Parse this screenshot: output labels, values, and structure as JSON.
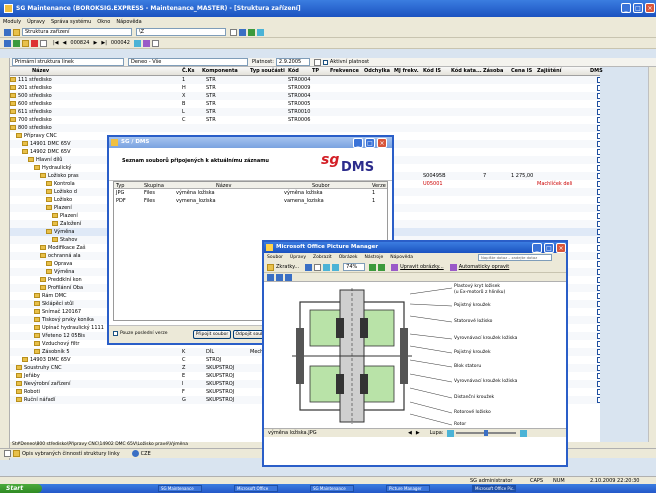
{
  "app": {
    "title": "SG Maintenance (BOROKSIG.EXPRESS - Maintenance_MASTER) - [Struktura zařízení]",
    "menu": [
      "Moduly",
      "Úpravy",
      "Správa systému",
      "Okno",
      "Nápověda"
    ],
    "toolbar1": {
      "combo_label": "Struktura zařízení",
      "combo_filter": "\\Z"
    },
    "toolbar2": {
      "record_prev": "000824",
      "record_next": "000042"
    },
    "filter": {
      "tree_combo": "Primární struktura linek",
      "zone_combo": "Deneo - Vše",
      "validity_label": "Platnost:",
      "validity_date": "2.9.2005",
      "active_validity": "Aktivní platnost"
    }
  },
  "grid": {
    "columns": [
      "Název",
      "Č.Ks",
      "Komponenta",
      "Typ součásti",
      "Kód",
      "TP",
      "Frekvence",
      "Odchylka",
      "MJ frekv.",
      "Kód IS",
      "Kód kata...",
      "Zásoba",
      "Cena IS",
      "Zajištění",
      "DMS"
    ],
    "rows": [
      {
        "name": "111 středisko",
        "ks": "1",
        "komp": "STR",
        "kod": "STR0004"
      },
      {
        "name": "201 středisko",
        "ks": "H",
        "komp": "STR",
        "kod": "STR0009"
      },
      {
        "name": "500 středisko",
        "ks": "X",
        "komp": "STR",
        "kod": "STR0004"
      },
      {
        "name": "600 středisko",
        "ks": "B",
        "komp": "STR",
        "kod": "STR0005"
      },
      {
        "name": "611 středisko",
        "ks": "L",
        "komp": "STR",
        "kod": "STR0010"
      },
      {
        "name": "700 středisko",
        "ks": "C",
        "komp": "STR",
        "kod": "STR0006"
      },
      {
        "name": "800 středisko",
        "ks": "",
        "komp": "",
        "kod": ""
      },
      {
        "name": "Přípravy CNC",
        "ks": "",
        "komp": "",
        "kod": ""
      },
      {
        "name": "14901 DMC 65V",
        "ks": "",
        "komp": "",
        "kod": "ST0001",
        "kodis": ""
      },
      {
        "name": "14902 DMC 65V",
        "ks": "",
        "komp": "",
        "kod": "ST0001",
        "kodis": ""
      },
      {
        "name": "Hlavní dílů",
        "ks": "",
        "komp": "",
        "kod": ""
      },
      {
        "name": "Hydraulický",
        "ks": "",
        "komp": "",
        "kod": ""
      },
      {
        "name": "Ložisko pras",
        "ks": "",
        "komp": "",
        "kod": "15483",
        "kodis": "S00495B",
        "zasoba": "7",
        "cena": "1 275,00"
      },
      {
        "name": "Kontrola",
        "ks": "",
        "komp": "",
        "kod": "den",
        "kodis": "U05001",
        "zajisteni": "Machlíček deli"
      },
      {
        "name": "Ložisko d",
        "ks": "",
        "komp": "",
        "kod": ""
      },
      {
        "name": "Ložisko",
        "ks": "",
        "komp": "",
        "kod": ""
      },
      {
        "name": "Plazení",
        "ks": "",
        "komp": "",
        "kod": ""
      },
      {
        "name": "Plazení",
        "ks": "",
        "komp": "",
        "kod": ""
      },
      {
        "name": "Založení",
        "ks": "",
        "komp": "",
        "kod": ""
      },
      {
        "name": "Výměna",
        "ks": "",
        "komp": "",
        "kod": ""
      },
      {
        "name": "Stahov",
        "ks": "",
        "komp": "",
        "kod": ""
      },
      {
        "name": "Modifikace Zaš",
        "ks": "",
        "komp": "",
        "kod": ""
      },
      {
        "name": "ochranná ala",
        "ks": "",
        "komp": "",
        "kod": ""
      },
      {
        "name": "Oprava",
        "ks": "",
        "komp": "",
        "kod": ""
      },
      {
        "name": "Výměna",
        "ks": "",
        "komp": "",
        "kod": ""
      },
      {
        "name": "Preddklní kon",
        "ks": "",
        "komp": "",
        "kod": ""
      },
      {
        "name": "Profilánní Oba",
        "ks": "",
        "komp": "",
        "kod": ""
      },
      {
        "name": "Rám DMC",
        "ks": "",
        "komp": "",
        "kod": ""
      },
      {
        "name": "Sklápěcí stůl",
        "ks": "",
        "komp": "",
        "kod": ""
      },
      {
        "name": "Snímač 120167",
        "ks": "F",
        "komp": "DÍL",
        "typ": "Elektro"
      },
      {
        "name": "Tiskový prvky konika",
        "ks": "H",
        "komp": "DÍL",
        "typ": "Mechan"
      },
      {
        "name": "Upínač hydraulický 1111",
        "ks": "G",
        "komp": "DÍL",
        "typ": "Mechan"
      },
      {
        "name": "Vřeteno 12 05Bis",
        "ks": "J",
        "komp": "DÍL",
        "typ": "Mechan"
      },
      {
        "name": "Vzduchový filtr",
        "ks": "L",
        "komp": "DÍL",
        "typ": "Mechan"
      },
      {
        "name": "Zásobník 5",
        "ks": "K",
        "komp": "DÍL",
        "typ": "Mechan"
      },
      {
        "name": "14903 DMC 65V",
        "ks": "C",
        "komp": "STROJ",
        "typ": ""
      },
      {
        "name": "Soustruhy CNC",
        "ks": "Z",
        "komp": "SKUPSTROJ",
        "typ": ""
      },
      {
        "name": "Jeřáby",
        "ks": "E",
        "komp": "SKUPSTROJ",
        "typ": ""
      },
      {
        "name": "Nevýrobní zařízení",
        "ks": "I",
        "komp": "SKUPSTROJ",
        "typ": ""
      },
      {
        "name": "Roboti",
        "ks": "F",
        "komp": "SKUPSTROJ",
        "typ": "",
        "kod": "SST0015"
      },
      {
        "name": "Ruční nářadí",
        "ks": "G",
        "komp": "SKUPSTROJ",
        "typ": "",
        "kod": "SST0013"
      }
    ]
  },
  "status": {
    "path": "St#Deneo\\800 středisko\\Přípravy CNC\\14902 DMC 65V\\Ložisko pravé\\Výměna",
    "copy_label": "Opis vybraných činností struktury linky",
    "country": "CZE"
  },
  "appstatus": {
    "user": "SG administrator",
    "caps": "CAPS",
    "num": "NUM",
    "datetime": "2.10.2009 22:20:30"
  },
  "taskbar": {
    "start": "Start",
    "tasks": [
      "SG Maintenance",
      "Microsoft Office",
      "SG Maintenance",
      "Picture Manager",
      "Microsoft Office Pic..."
    ]
  },
  "dms_dialog": {
    "title": "SG / DMS",
    "heading": "Seznam souborů připojených k aktuálnímu záznamu",
    "logo_sg": "sg",
    "logo_dms": "DMS",
    "columns": [
      "Typ",
      "Skupina",
      "Název",
      "Soubor",
      "Verze"
    ],
    "files": [
      {
        "typ": "JPG",
        "skupina": "Files",
        "nazev": "výměna ložiska",
        "soubor": "výměna ložiska",
        "verze": "1"
      },
      {
        "typ": "PDF",
        "skupina": "Files",
        "nazev": "vymena_loziska",
        "soubor": "vamena_loziska",
        "verze": "1"
      }
    ],
    "only_last": "Pouze poslední verze",
    "attach_btn": "Připojit soubor",
    "detach_btn": "Odpojit soubor"
  },
  "picture_manager": {
    "title": "Microsoft Office Picture Manager",
    "menu": [
      "Soubor",
      "Úpravy",
      "Zobrazit",
      "Obrázek",
      "Nástroje",
      "Nápověda"
    ],
    "help_placeholder": "Napište dotaz – zadejte dotaz",
    "toolbar": {
      "shortcuts": "Zkratky...",
      "zoom": "74%",
      "edit_btn": "Upravit obrázky...",
      "auto_btn": "Automaticky opravit"
    },
    "labels": [
      "Plastový kryt ložisek",
      "(u Ex-motorů z hliníku)",
      "Pojistný kroužek",
      "Statorové ložisko",
      "Vyrovnávací kroužek ložiska",
      "Pojistný kroužek",
      "Blok statoru",
      "Vyrovnávací kroužek ložiska",
      "Distanční kroužek",
      "Rotorové ložisko",
      "Rotor"
    ],
    "status_file": "výměna ložiska.JPG",
    "status_zoom": "Lupa:"
  }
}
